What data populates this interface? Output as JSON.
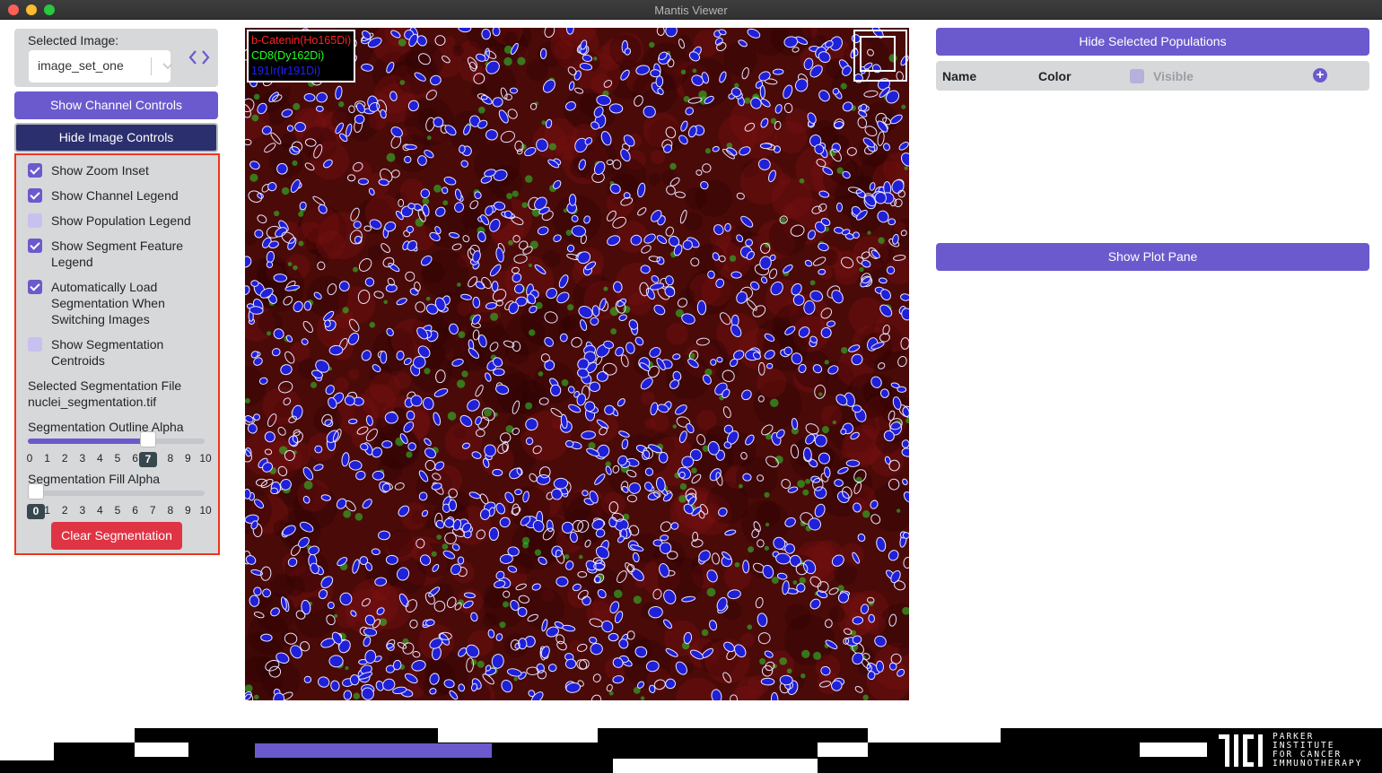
{
  "window": {
    "title": "Mantis Viewer"
  },
  "left_panel": {
    "selected_image_label": "Selected Image:",
    "selected_image_value": "image_set_one",
    "prev_next_icon": "chevron-left-right-icon",
    "show_channel_controls": "Show Channel Controls",
    "hide_image_controls": "Hide Image Controls",
    "checkboxes": [
      {
        "label": "Show Zoom Inset",
        "checked": true
      },
      {
        "label": "Show Channel Legend",
        "checked": true
      },
      {
        "label": "Show Population Legend",
        "checked": false
      },
      {
        "label": "Show Segment Feature Legend",
        "checked": true
      },
      {
        "label": "Automatically Load Segmentation When Switching Images",
        "checked": true
      },
      {
        "label": "Show Segmentation Centroids",
        "checked": false
      }
    ],
    "segmentation_file_label": "Selected Segmentation File",
    "segmentation_file_value": "nuclei_segmentation.tif",
    "outline_alpha": {
      "label": "Segmentation Outline Alpha",
      "value": 7,
      "min": 0,
      "max": 10,
      "badge": "7"
    },
    "fill_alpha": {
      "label": "Segmentation Fill Alpha",
      "value": 0,
      "min": 0,
      "max": 10,
      "badge": "0"
    },
    "ticks": [
      "0",
      "1",
      "2",
      "3",
      "4",
      "5",
      "6",
      "7",
      "8",
      "9",
      "10"
    ],
    "clear_segmentation": "Clear Segmentation"
  },
  "image": {
    "channel_legend": [
      {
        "label": "b-Catenin(Ho165Di)",
        "color": "#ff2020"
      },
      {
        "label": "CD8(Dy162Di)",
        "color": "#20ff20"
      },
      {
        "label": "191Ir(Ir191Di)",
        "color": "#2020ff"
      }
    ]
  },
  "right_panel": {
    "hide_selected_populations": "Hide Selected Populations",
    "table_headers": {
      "name": "Name",
      "color": "Color",
      "visible": "Visible"
    },
    "add_icon": "plus-circle-icon",
    "show_plot_pane": "Show Plot Pane"
  },
  "footer": {
    "logo_lines": [
      "PARKER",
      "INSTITUTE",
      "FOR CANCER",
      "IMMUNOTHERAPY"
    ]
  },
  "colors": {
    "accent": "#6a5acd",
    "dark_button": "#2c2f6e",
    "danger": "#df3444",
    "highlight_border": "#f0341c"
  }
}
